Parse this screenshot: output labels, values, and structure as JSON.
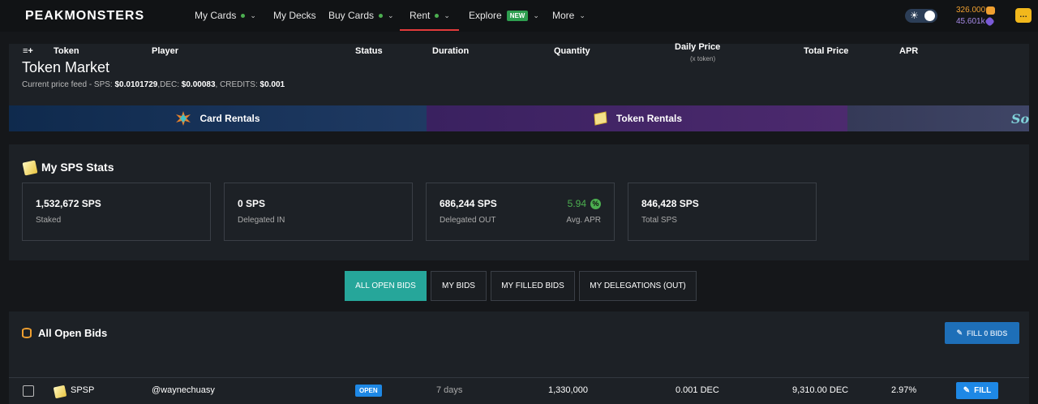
{
  "nav": {
    "logo": "PEAKMONSTERS",
    "items": [
      {
        "label": "My Cards"
      },
      {
        "label": "My Decks"
      },
      {
        "label": "Buy Cards"
      },
      {
        "label": "Rent"
      },
      {
        "label": "Explore",
        "badge": "NEW"
      },
      {
        "label": "More"
      }
    ],
    "balance_dec": "326.000",
    "balance_sps": "45.601k",
    "colors": {
      "accent": "#e23b3b",
      "green": "#4caf50"
    }
  },
  "header": {
    "title": "Token Market",
    "pricefeed_prefix": "Current price feed - SPS: ",
    "sps_price": "$0.0101729",
    "dec_prefix": ",DEC: ",
    "dec_price": "$0.00083",
    "credits_prefix": ", CREDITS: ",
    "credits_price": "$0.001",
    "banners": [
      {
        "label": "Card Rentals",
        "icon": "card-gem-icon"
      },
      {
        "label": "Token Rentals",
        "icon": "token-icon"
      },
      {
        "label": "Sou",
        "icon": "logo"
      }
    ]
  },
  "stats": {
    "title": "My SPS Stats",
    "boxes": [
      {
        "value": "1,532,672 SPS",
        "label": "Staked"
      },
      {
        "value": "0 SPS",
        "label": "Delegated IN"
      },
      {
        "value": "686,244 SPS",
        "label": "Delegated OUT",
        "apr": "5.94",
        "apr_label": "Avg. APR"
      },
      {
        "value": "846,428 SPS",
        "label": "Total SPS"
      }
    ]
  },
  "tabs": [
    "ALL OPEN BIDS",
    "MY BIDS",
    "MY FILLED BIDS",
    "MY DELEGATIONS (OUT)"
  ],
  "bids": {
    "title": "All Open Bids",
    "fill_all_label": "FILL 0 BIDS",
    "columns": {
      "token": "Token",
      "player": "Player",
      "status": "Status",
      "duration": "Duration",
      "quantity": "Quantity",
      "daily_price": "Daily Price",
      "daily_price_sub": "(x token)",
      "total_price": "Total Price",
      "apr": "APR"
    },
    "rows": [
      {
        "token": "SPSP",
        "player": "@waynechuasy",
        "status": "OPEN",
        "duration": "7 days",
        "quantity": "1,330,000",
        "daily_price": "0.001 DEC",
        "total_price": "9,310.00 DEC",
        "apr": "2.97%",
        "action": "FILL"
      }
    ]
  }
}
